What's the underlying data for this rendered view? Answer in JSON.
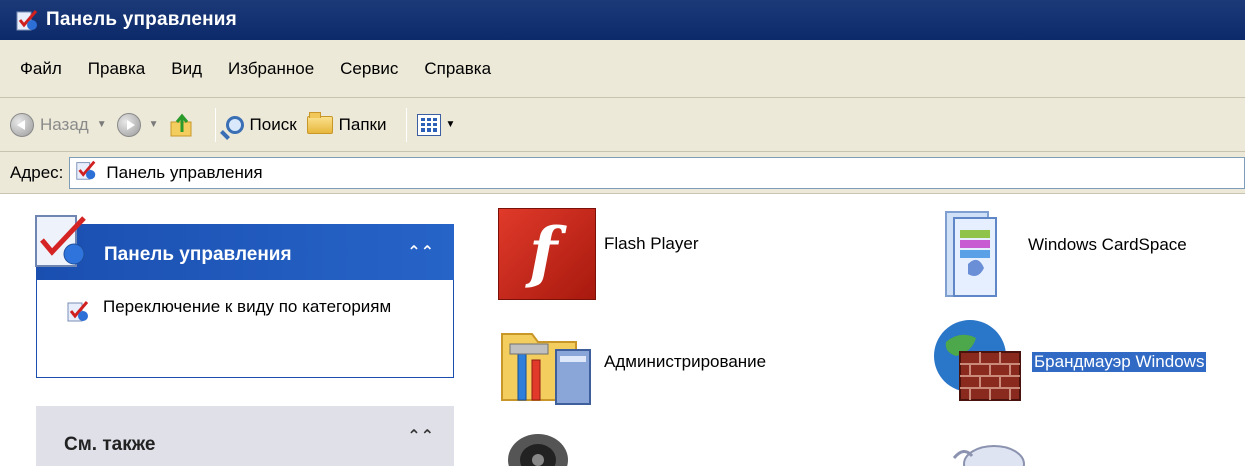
{
  "window": {
    "title": "Панель управления"
  },
  "menu": {
    "items": [
      "Файл",
      "Правка",
      "Вид",
      "Избранное",
      "Сервис",
      "Справка"
    ]
  },
  "toolbar": {
    "back_label": "Назад",
    "search_label": "Поиск",
    "folders_label": "Папки"
  },
  "address": {
    "label": "Адрес:",
    "value": "Панель управления"
  },
  "left_pane": {
    "panel_title": "Панель управления",
    "switch_view_link": "Переключение к виду по категориям",
    "see_also_title": "См. также"
  },
  "content": {
    "items": [
      {
        "label": "Flash Player",
        "icon": "flash-player-icon"
      },
      {
        "label": "Windows CardSpace",
        "icon": "cardspace-icon"
      },
      {
        "label": "Администрирование",
        "icon": "administration-icon"
      },
      {
        "label": "Брандмауэр Windows",
        "icon": "firewall-icon",
        "selected": true
      }
    ]
  },
  "colors": {
    "title_bar": "#0c2a6a",
    "chrome": "#ece9d8",
    "panel_header": "#1a4fb0",
    "selection": "#316ac5"
  }
}
